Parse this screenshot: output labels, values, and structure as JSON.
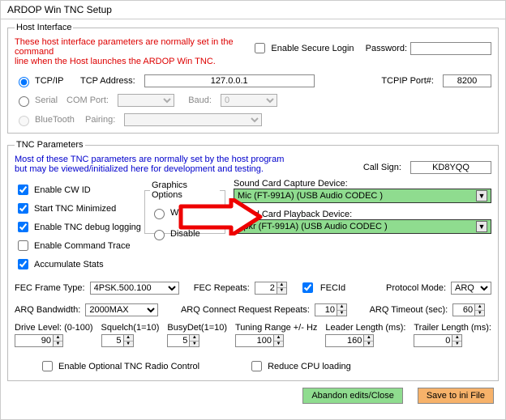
{
  "window": {
    "title": "ARDOP Win TNC Setup"
  },
  "host": {
    "legend": "Host Interface",
    "note1": "These host interface parameters are normally set in the command",
    "note2": "line when the Host launches the ARDOP Win TNC.",
    "enable_secure_login": "Enable Secure Login",
    "password_label": "Password:",
    "password_value": "",
    "tcpip_label": "TCP/IP",
    "tcp_address_label": "TCP Address:",
    "tcp_address_value": "127.0.0.1",
    "tcpip_port_label": "TCPIP Port#:",
    "tcpip_port_value": "8200",
    "serial_label": "Serial",
    "com_port_label": "COM Port:",
    "com_port_value": "",
    "baud_label": "Baud:",
    "baud_value": "0",
    "bluetooth_label": "BlueTooth",
    "pairing_label": "Pairing:",
    "pairing_value": ""
  },
  "tnc": {
    "legend": "TNC Parameters",
    "note1": "Most of these TNC parameters are normally set by the host program",
    "note2": "but may be viewed/initialized here for development and testing.",
    "call_sign_label": "Call Sign:",
    "call_sign_value": "KD8YQQ",
    "cb_cwid": "Enable CW ID",
    "cb_start_min": "Start TNC Minimized",
    "cb_debug": "Enable TNC debug logging",
    "cb_cmd_trace": "Enable Command Trace",
    "cb_accum": "Accumulate Stats",
    "gfx_legend": "Graphics Options",
    "gfx_waterfall": "Waterfall",
    "gfx_disable": "Disable",
    "capture_label": "Sound Card Capture Device:",
    "capture_value": "Mic (FT-991A) (USB Audio CODEC )",
    "playback_label": "Sound Card Playback Device:",
    "playback_value": "Spkr (FT-991A) (USB Audio CODEC )",
    "fec_frame_label": "FEC Frame Type:",
    "fec_frame_value": "4PSK.500.100",
    "fec_repeats_label": "FEC Repeats:",
    "fec_repeats_value": "2",
    "fecid_label": "FECId",
    "protocol_mode_label": "Protocol Mode:",
    "protocol_mode_value": "ARQ",
    "arq_bw_label": "ARQ Bandwidth:",
    "arq_bw_value": "2000MAX",
    "arq_conn_req_label": "ARQ Connect Request Repeats:",
    "arq_conn_req_value": "10",
    "arq_timeout_label": "ARQ Timeout (sec):",
    "arq_timeout_value": "60",
    "drive_label": "Drive Level: (0-100)",
    "drive_value": "90",
    "squelch_label": "Squelch(1=10)",
    "squelch_value": "5",
    "busydet_label": "BusyDet(1=10)",
    "busydet_value": "5",
    "tuning_label": "Tuning Range +/- Hz",
    "tuning_value": "100",
    "leader_label": "Leader Length (ms):",
    "leader_value": "160",
    "trailer_label": "Trailer Length (ms):",
    "trailer_value": "0",
    "cb_radio_ctrl": "Enable Optional TNC Radio Control",
    "cb_reduce_cpu": "Reduce CPU loading"
  },
  "buttons": {
    "abandon": "Abandon edits/Close",
    "save": "Save to ini File"
  }
}
